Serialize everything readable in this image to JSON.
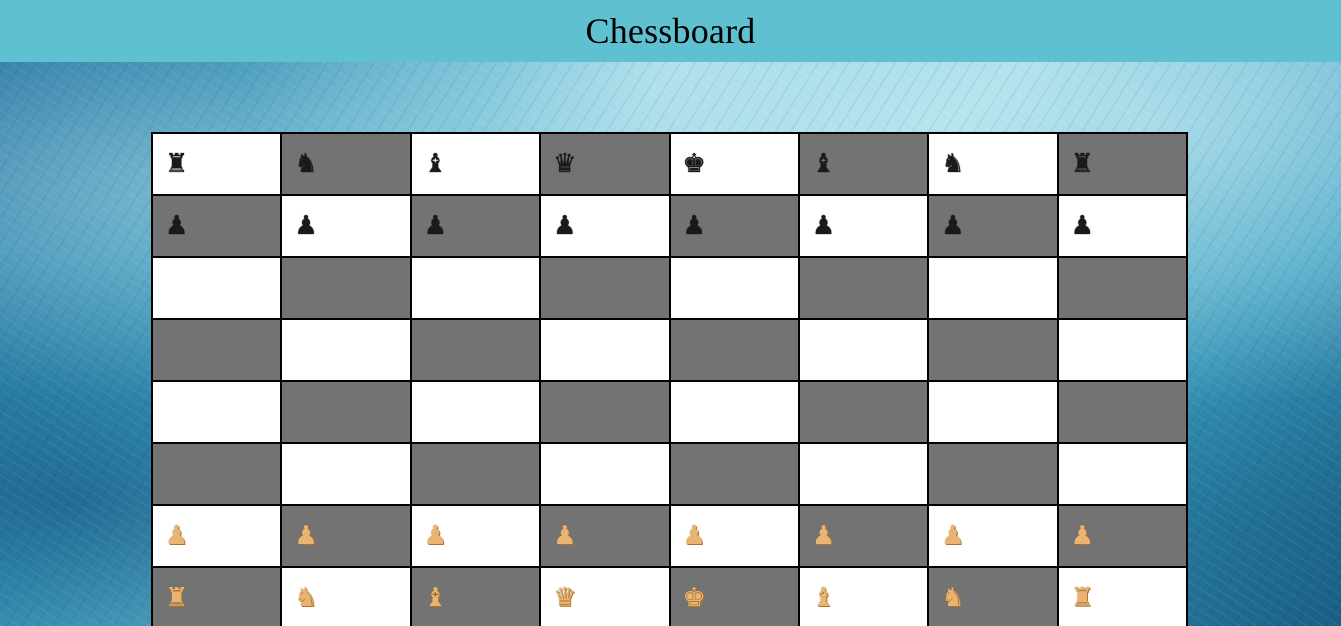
{
  "header": {
    "title": "Chessboard"
  },
  "board": {
    "colors": {
      "light": "#ffffff",
      "dark": "#737373",
      "black_piece": "#1a1a1a",
      "white_piece": "#e9b472"
    },
    "ranks": [
      [
        {
          "piece": "rook",
          "side": "black",
          "glyph": "♜"
        },
        {
          "piece": "knight",
          "side": "black",
          "glyph": "♞"
        },
        {
          "piece": "bishop",
          "side": "black",
          "glyph": "♝"
        },
        {
          "piece": "queen",
          "side": "black",
          "glyph": "♛"
        },
        {
          "piece": "king",
          "side": "black",
          "glyph": "♚"
        },
        {
          "piece": "bishop",
          "side": "black",
          "glyph": "♝"
        },
        {
          "piece": "knight",
          "side": "black",
          "glyph": "♞"
        },
        {
          "piece": "rook",
          "side": "black",
          "glyph": "♜"
        }
      ],
      [
        {
          "piece": "pawn",
          "side": "black",
          "glyph": "♟"
        },
        {
          "piece": "pawn",
          "side": "black",
          "glyph": "♟"
        },
        {
          "piece": "pawn",
          "side": "black",
          "glyph": "♟"
        },
        {
          "piece": "pawn",
          "side": "black",
          "glyph": "♟"
        },
        {
          "piece": "pawn",
          "side": "black",
          "glyph": "♟"
        },
        {
          "piece": "pawn",
          "side": "black",
          "glyph": "♟"
        },
        {
          "piece": "pawn",
          "side": "black",
          "glyph": "♟"
        },
        {
          "piece": "pawn",
          "side": "black",
          "glyph": "♟"
        }
      ],
      [
        null,
        null,
        null,
        null,
        null,
        null,
        null,
        null
      ],
      [
        null,
        null,
        null,
        null,
        null,
        null,
        null,
        null
      ],
      [
        null,
        null,
        null,
        null,
        null,
        null,
        null,
        null
      ],
      [
        null,
        null,
        null,
        null,
        null,
        null,
        null,
        null
      ],
      [
        {
          "piece": "pawn",
          "side": "white",
          "glyph": "♟"
        },
        {
          "piece": "pawn",
          "side": "white",
          "glyph": "♟"
        },
        {
          "piece": "pawn",
          "side": "white",
          "glyph": "♟"
        },
        {
          "piece": "pawn",
          "side": "white",
          "glyph": "♟"
        },
        {
          "piece": "pawn",
          "side": "white",
          "glyph": "♟"
        },
        {
          "piece": "pawn",
          "side": "white",
          "glyph": "♟"
        },
        {
          "piece": "pawn",
          "side": "white",
          "glyph": "♟"
        },
        {
          "piece": "pawn",
          "side": "white",
          "glyph": "♟"
        }
      ],
      [
        {
          "piece": "rook",
          "side": "white",
          "glyph": "♜"
        },
        {
          "piece": "knight",
          "side": "white",
          "glyph": "♞"
        },
        {
          "piece": "bishop",
          "side": "white",
          "glyph": "♝"
        },
        {
          "piece": "queen",
          "side": "white",
          "glyph": "♛"
        },
        {
          "piece": "king",
          "side": "white",
          "glyph": "♚"
        },
        {
          "piece": "bishop",
          "side": "white",
          "glyph": "♝"
        },
        {
          "piece": "knight",
          "side": "white",
          "glyph": "♞"
        },
        {
          "piece": "rook",
          "side": "white",
          "glyph": "♜"
        }
      ]
    ]
  }
}
